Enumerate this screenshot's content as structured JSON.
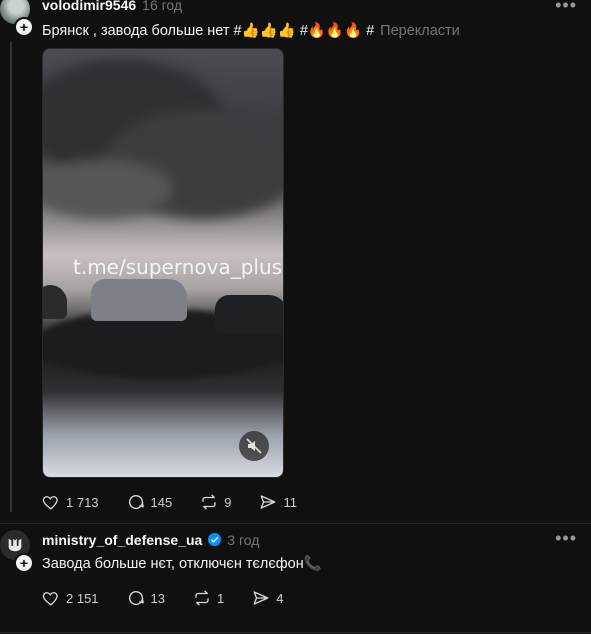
{
  "posts": [
    {
      "username": "volodimir9546",
      "time": "16 год",
      "text": "Брянск , завода больше нет #👍👍👍 #🔥🔥🔥 #",
      "translate_label": "Перекласти",
      "media": {
        "watermark": "t.me/supernova_plus",
        "mute_icon": "speaker-muted-icon"
      },
      "stats": {
        "likes": "1 713",
        "comments": "145",
        "reposts": "9",
        "shares": "11"
      }
    },
    {
      "username": "ministry_of_defense_ua",
      "verified": true,
      "time": "3 год",
      "text": "Завода больше нєт, отключєн тєлєфон📞",
      "stats": {
        "likes": "2 151",
        "comments": "13",
        "reposts": "1",
        "shares": "4"
      }
    }
  ],
  "colors": {
    "background": "#101010",
    "text": "#f3f5f7",
    "muted": "#777777",
    "verified": "#0095f6"
  }
}
